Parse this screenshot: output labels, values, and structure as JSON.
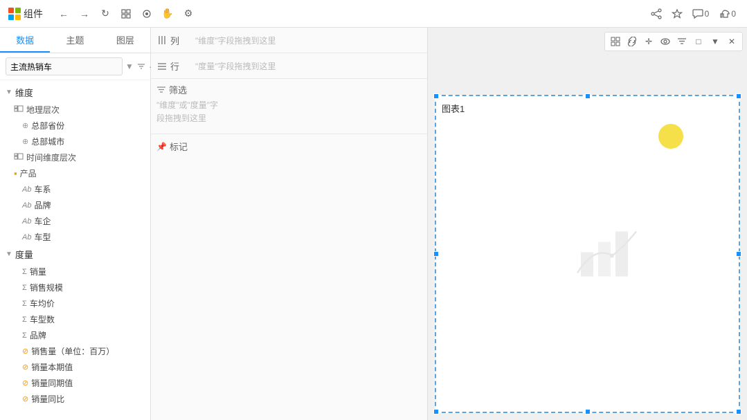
{
  "toolbar": {
    "logo_colors": [
      "#f25022",
      "#7fba00",
      "#00a4ef",
      "#ffb900"
    ],
    "title": "组件",
    "nav_buttons": [
      "←",
      "→",
      "↺",
      "⊞",
      "⊙",
      "✋",
      "⚙"
    ],
    "right_buttons": [
      {
        "icon": "share",
        "label": "⬡",
        "count": ""
      },
      {
        "icon": "star",
        "label": "☆",
        "count": ""
      },
      {
        "icon": "comment",
        "label": "💬",
        "count": "0"
      },
      {
        "icon": "like",
        "label": "👍",
        "count": "0"
      }
    ]
  },
  "sidebar": {
    "tabs": [
      {
        "label": "数据",
        "active": true
      },
      {
        "label": "主题",
        "active": false
      },
      {
        "label": "图层",
        "active": false
      }
    ],
    "search_placeholder": "主流热销车",
    "dimension_label": "维度",
    "geo_group": "地理层次",
    "geo_items": [
      "总部省份",
      "总部城市"
    ],
    "time_group": "时间维度层次",
    "product_group": "产品",
    "product_items": [
      "车系",
      "品牌",
      "车企",
      "车型"
    ],
    "measure_label": "度量",
    "measure_items": [
      "销量",
      "销售规模",
      "车均价",
      "车型数",
      "品牌"
    ],
    "calc_items": [
      "销售量（单位：百万）",
      "销量本期值",
      "销量同期值",
      "销量同比"
    ]
  },
  "middle": {
    "col_label": "列",
    "col_placeholder": "\"维度\"字段拖拽到这里",
    "row_label": "行",
    "row_placeholder": "\"度量\"字段拖拽到这里",
    "filter_label": "筛选",
    "filter_placeholder": "\"维度\"或\"度量\"字\n段拖拽到这里",
    "mark_label": "标记"
  },
  "chart": {
    "title": "图表1",
    "toolbar_buttons": [
      "⊞",
      "🔗",
      "✛",
      "⊙",
      "▽",
      "□",
      "▼",
      "✕"
    ]
  }
}
